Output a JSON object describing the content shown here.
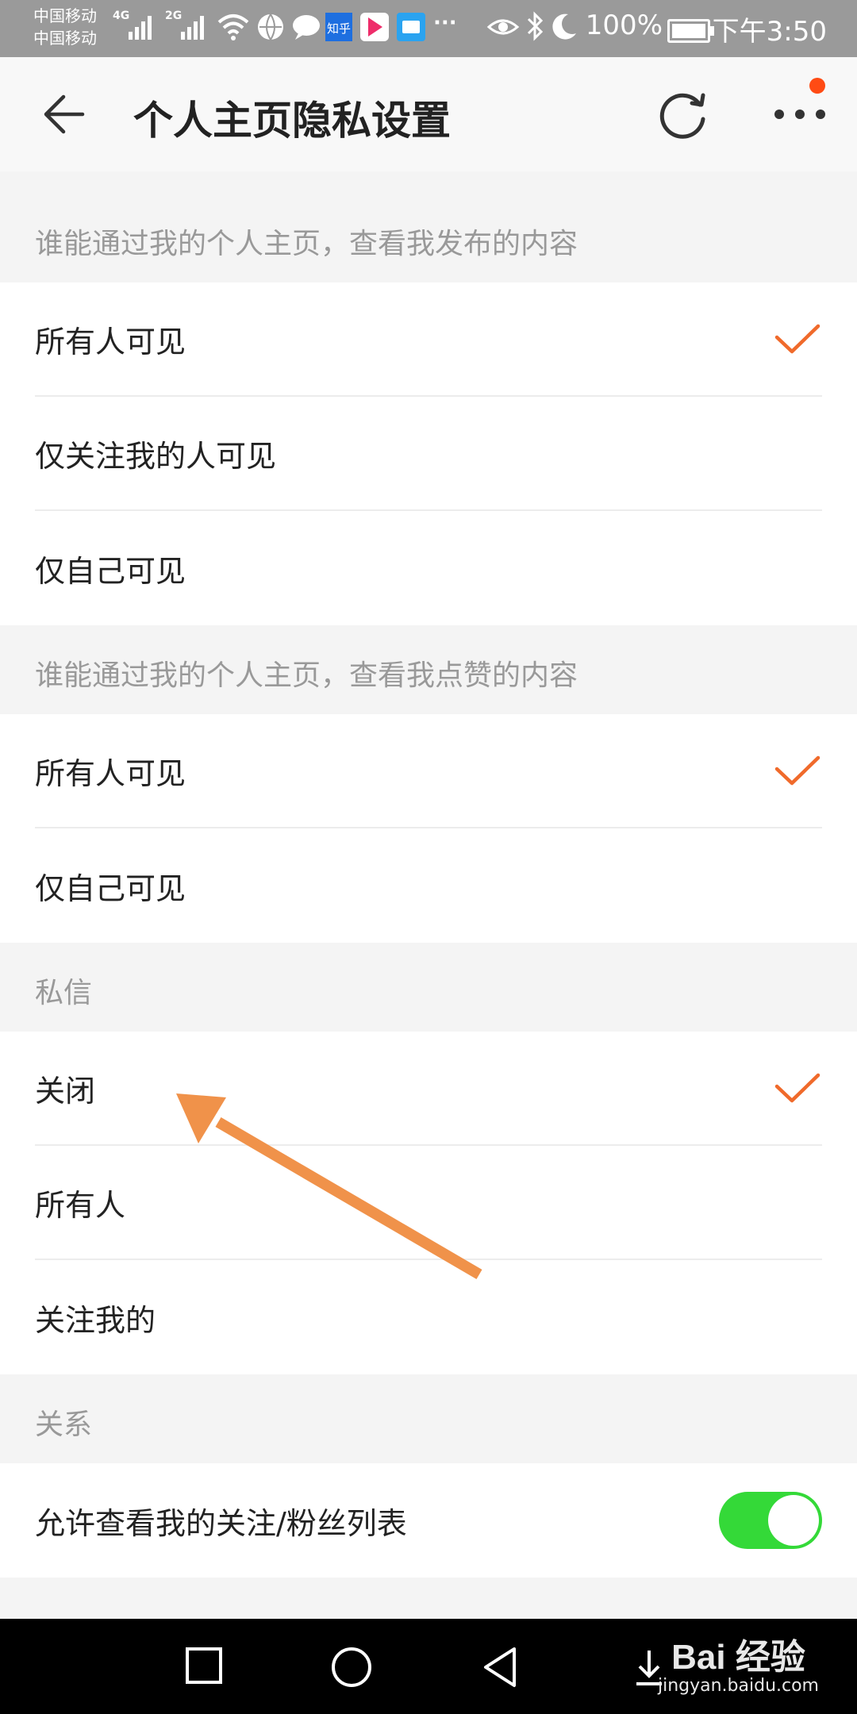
{
  "status_bar": {
    "carrier_1": "中国移动",
    "carrier_2": "中国移动",
    "net_1": "4G",
    "net_2": "2G",
    "app_icons": [
      "globe-icon",
      "chat-icon",
      "zhihu-icon",
      "video-app-icon",
      "tv-app-icon"
    ],
    "more": "···",
    "battery": "100%",
    "time": "下午3:50"
  },
  "header": {
    "title": "个人主页隐私设置"
  },
  "sections": {
    "posts": {
      "title": "谁能通过我的个人主页，查看我发布的内容",
      "options": [
        "所有人可见",
        "仅关注我的人可见",
        "仅自己可见"
      ],
      "selected_index": 0
    },
    "likes": {
      "title": "谁能通过我的个人主页，查看我点赞的内容",
      "options": [
        "所有人可见",
        "仅自己可见"
      ],
      "selected_index": 0
    },
    "messages": {
      "title": "私信",
      "options": [
        "关闭",
        "所有人",
        "关注我的"
      ],
      "selected_index": 0
    },
    "relations": {
      "title": "关系",
      "toggle_label": "允许查看我的关注/粉丝列表",
      "toggle_on": true
    }
  },
  "colors": {
    "accent": "#f06a2b",
    "toggle_on": "#34d938",
    "annotation_arrow": "#f0924a",
    "notification_dot": "#ff4b14"
  },
  "watermark": {
    "main": "Bai 经验",
    "sub": "jingyan.baidu.com"
  }
}
